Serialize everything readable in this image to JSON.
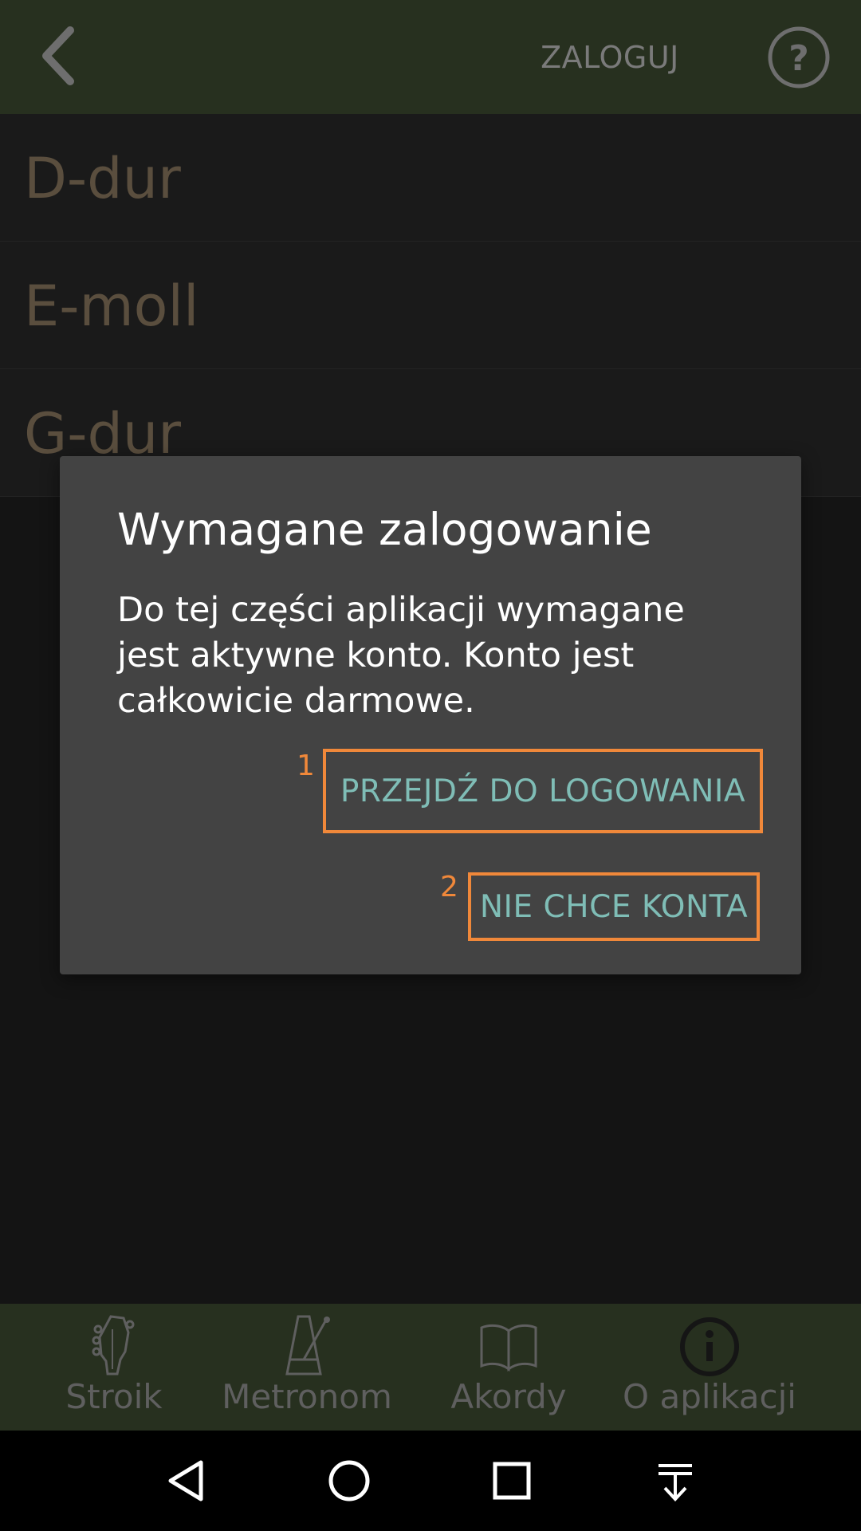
{
  "header": {
    "login_label": "ZALOGUJ",
    "back_icon": "chevron-left-icon",
    "help_icon": "question-circle-icon"
  },
  "chords": [
    {
      "label": "D-dur"
    },
    {
      "label": "E-moll"
    },
    {
      "label": "G-dur"
    }
  ],
  "dialog": {
    "title": "Wymagane zalogowanie",
    "message": "Do tej części aplikacji wymagane jest aktywne konto. Konto jest całkowicie darmowe.",
    "annotation_1": "1",
    "annotation_2": "2",
    "primary_button": "PRZEJDŹ DO LOGOWANIA",
    "secondary_button": "NIE CHCE KONTA"
  },
  "bottom_nav": {
    "items": [
      {
        "label": "Stroik",
        "icon": "guitar-headstock-icon"
      },
      {
        "label": "Metronom",
        "icon": "metronome-icon"
      },
      {
        "label": "Akordy",
        "icon": "book-icon"
      },
      {
        "label": "O aplikacji",
        "icon": "info-circle-icon"
      }
    ]
  },
  "system_nav": {
    "icons": [
      "back-triangle-icon",
      "home-circle-icon",
      "recents-square-icon",
      "notification-pull-icon"
    ]
  },
  "colors": {
    "header_bg": "#27301f",
    "accent_orange": "#f0883a",
    "button_text": "#7fbdb6",
    "dialog_bg": "#434343"
  }
}
